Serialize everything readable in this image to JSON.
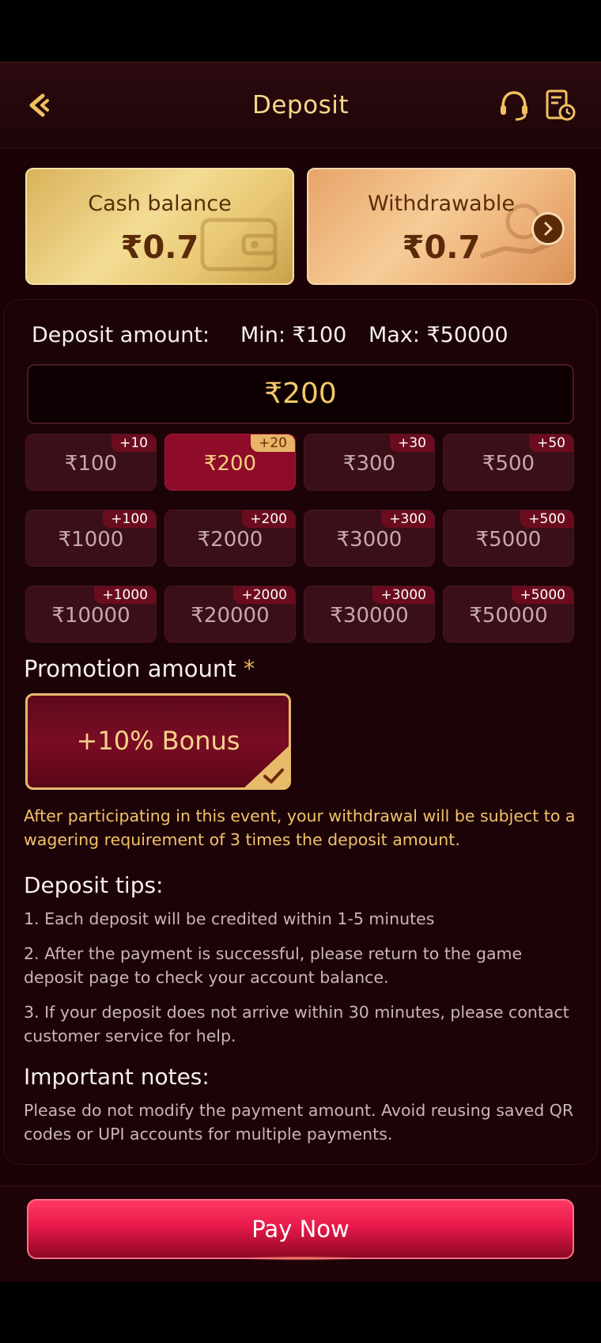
{
  "header": {
    "title": "Deposit"
  },
  "balances": {
    "cash": {
      "label": "Cash balance",
      "value": "₹0.7"
    },
    "withdrawable": {
      "label": "Withdrawable",
      "value": "₹0.7"
    }
  },
  "deposit": {
    "label": "Deposit amount:",
    "min": "Min: ₹100",
    "max": "Max: ₹50000",
    "value": "₹200",
    "options": [
      {
        "amount": "₹100",
        "bonus": "+10"
      },
      {
        "amount": "₹200",
        "bonus": "+20",
        "selected": true
      },
      {
        "amount": "₹300",
        "bonus": "+30"
      },
      {
        "amount": "₹500",
        "bonus": "+50"
      },
      {
        "amount": "₹1000",
        "bonus": "+100"
      },
      {
        "amount": "₹2000",
        "bonus": "+200"
      },
      {
        "amount": "₹3000",
        "bonus": "+300"
      },
      {
        "amount": "₹5000",
        "bonus": "+500"
      },
      {
        "amount": "₹10000",
        "bonus": "+1000"
      },
      {
        "amount": "₹20000",
        "bonus": "+2000"
      },
      {
        "amount": "₹30000",
        "bonus": "+3000"
      },
      {
        "amount": "₹50000",
        "bonus": "+5000"
      }
    ]
  },
  "promotion": {
    "title": "Promotion amount",
    "required_mark": "*",
    "option": "+10% Bonus",
    "note": "After participating in this event, your withdrawal will be subject to a wagering requirement of 3 times the deposit amount."
  },
  "tips": {
    "title": "Deposit tips:",
    "items": [
      "1. Each deposit will be credited within 1-5 minutes",
      "2. After the payment is successful, please return to the game deposit page to check your account balance.",
      "3. If your deposit does not arrive within 30 minutes, please contact customer service for help."
    ]
  },
  "notes": {
    "title": "Important notes:",
    "text": "Please do not modify the payment amount. Avoid reusing saved QR codes or UPI accounts for multiple payments."
  },
  "actions": {
    "pay_label": "Pay Now"
  },
  "colors": {
    "accent_gold": "#f6d88a",
    "selected_chip": "#8e0c2a",
    "pay_button": "#e8194a"
  }
}
